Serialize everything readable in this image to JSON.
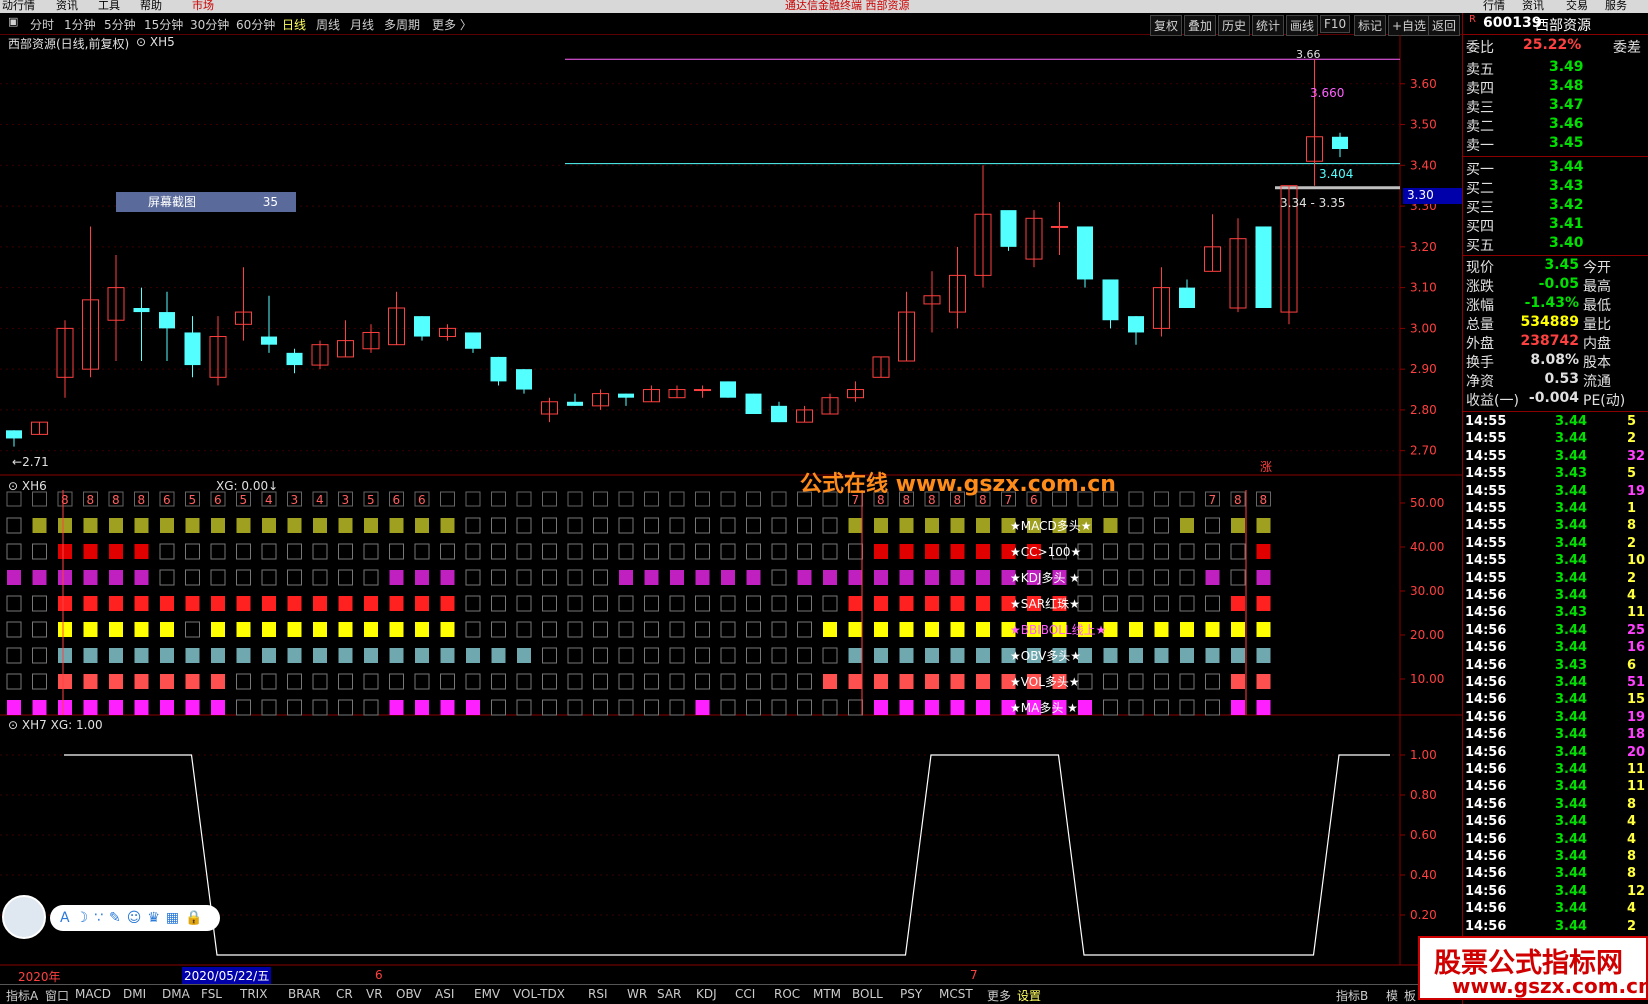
{
  "menubar": {
    "items": [
      "动行情",
      "资讯",
      "工具",
      "帮助",
      "市场"
    ],
    "title": "通达信金融终端  西部资源",
    "right_items": [
      "行情",
      "资讯",
      "交易",
      "服务"
    ]
  },
  "periods": [
    "分时",
    "1分钟",
    "5分钟",
    "15分钟",
    "30分钟",
    "60分钟",
    "日线",
    "周线",
    "月线",
    "多周期",
    "更多 〉"
  ],
  "toolbar": [
    "复权",
    "叠加",
    "历史",
    "统计",
    "画线",
    "F10",
    "标记",
    "+自选",
    "返回"
  ],
  "chart": {
    "title": "西部资源(日线,前复权)",
    "indicator": "XH5",
    "hi_label": "3.66",
    "hi_label2": "3.660",
    "mid_label": "3.404",
    "range_label": "3.34 - 3.35",
    "lo_label": "2.71",
    "cursor_price": "3.30",
    "zhang_tag": "涨",
    "screenshot_tooltip": "屏幕截图",
    "screenshot_num": "35",
    "price_ticks": [
      "3.60",
      "3.50",
      "3.40",
      "3.30",
      "3.20",
      "3.10",
      "3.00",
      "2.90",
      "2.80",
      "2.70"
    ]
  },
  "xh6": {
    "title": "XH6",
    "xg": "XG: 0.00↓",
    "watermark": "公式在线  www.gszx.com.cn",
    "row_labels": [
      "★MACD多头★",
      "★CC>100★",
      "★KDJ多头 ★",
      "★SAR红珠★",
      "★BBIBOLL线上★",
      "★OBV多头★",
      "★VOL多头★",
      "★MA多头 ★"
    ],
    "ticks": [
      "50.00",
      "40.00",
      "30.00",
      "20.00",
      "10.00"
    ],
    "counts": [
      "",
      "",
      "8",
      "8",
      "8",
      "8",
      "6",
      "5",
      "6",
      "5",
      "4",
      "3",
      "4",
      "3",
      "5",
      "6",
      "6",
      "",
      "",
      "",
      "",
      "",
      "",
      "",
      "",
      "",
      "",
      "",
      "",
      "",
      "",
      "",
      "",
      "7",
      "8",
      "8",
      "8",
      "8",
      "8",
      "7",
      "6",
      "",
      "",
      "",
      "",
      "",
      "",
      "7",
      "8",
      "8"
    ]
  },
  "xh7": {
    "title": "XH7",
    "xg": "XG: 1.00",
    "ticks": [
      "1.00",
      "0.80",
      "0.60",
      "0.40",
      "0.20"
    ]
  },
  "dates": {
    "year": "2020年",
    "cursor": "2020/05/22/五",
    "m6": "6",
    "m7": "7"
  },
  "bottom_tabs": [
    "指标A",
    "窗口",
    "MACD",
    "DMI",
    "DMA",
    "FSL",
    "TRIX",
    "BRAR",
    "CR",
    "VR",
    "OBV",
    "ASI",
    "EMV",
    "VOL-TDX",
    "RSI",
    "WR",
    "SAR",
    "KDJ",
    "CCI",
    "ROC",
    "MTM",
    "BOLL",
    "PSY",
    "MCST",
    "更多",
    "设置"
  ],
  "bottom_right": [
    "指标B",
    "模",
    "板"
  ],
  "stock": {
    "code": "600139",
    "name": "西部资源",
    "weibi_label": "委比",
    "weibi": "25.22%",
    "weicha_label": "委差",
    "sell": [
      {
        "label": "卖五",
        "price": "3.49"
      },
      {
        "label": "卖四",
        "price": "3.48"
      },
      {
        "label": "卖三",
        "price": "3.47"
      },
      {
        "label": "卖二",
        "price": "3.46"
      },
      {
        "label": "卖一",
        "price": "3.45"
      }
    ],
    "buy": [
      {
        "label": "买一",
        "price": "3.44"
      },
      {
        "label": "买二",
        "price": "3.43"
      },
      {
        "label": "买三",
        "price": "3.42"
      },
      {
        "label": "买四",
        "price": "3.41"
      },
      {
        "label": "买五",
        "price": "3.40"
      }
    ],
    "stats": [
      {
        "label": "现价",
        "value": "3.45",
        "right": "今开",
        "color": "#00e000"
      },
      {
        "label": "涨跌",
        "value": "-0.05",
        "right": "最高",
        "color": "#00e000"
      },
      {
        "label": "涨幅",
        "value": "-1.43%",
        "right": "最低",
        "color": "#00e000"
      },
      {
        "label": "总量",
        "value": "534889",
        "right": "量比",
        "color": "#ffff00"
      },
      {
        "label": "外盘",
        "value": "238742",
        "right": "内盘",
        "color": "#ff4040"
      },
      {
        "label": "换手",
        "value": "8.08%",
        "right": "股本",
        "color": "#e0e0e0"
      },
      {
        "label": "净资",
        "value": "0.53",
        "right": "流通",
        "color": "#e0e0e0"
      },
      {
        "label": "收益(一)",
        "value": "-0.004",
        "right": "PE(动)",
        "color": "#e0e0e0"
      }
    ],
    "ticks": [
      {
        "t": "14:55",
        "p": "3.44",
        "v": "5"
      },
      {
        "t": "14:55",
        "p": "3.44",
        "v": "2"
      },
      {
        "t": "14:55",
        "p": "3.44",
        "v": "32"
      },
      {
        "t": "14:55",
        "p": "3.43",
        "v": "5"
      },
      {
        "t": "14:55",
        "p": "3.44",
        "v": "19"
      },
      {
        "t": "14:55",
        "p": "3.44",
        "v": "1"
      },
      {
        "t": "14:55",
        "p": "3.44",
        "v": "8"
      },
      {
        "t": "14:55",
        "p": "3.44",
        "v": "2"
      },
      {
        "t": "14:55",
        "p": "3.44",
        "v": "10"
      },
      {
        "t": "14:55",
        "p": "3.44",
        "v": "2"
      },
      {
        "t": "14:56",
        "p": "3.44",
        "v": "4"
      },
      {
        "t": "14:56",
        "p": "3.43",
        "v": "11"
      },
      {
        "t": "14:56",
        "p": "3.44",
        "v": "25"
      },
      {
        "t": "14:56",
        "p": "3.44",
        "v": "16"
      },
      {
        "t": "14:56",
        "p": "3.43",
        "v": "6"
      },
      {
        "t": "14:56",
        "p": "3.44",
        "v": "51"
      },
      {
        "t": "14:56",
        "p": "3.44",
        "v": "15"
      },
      {
        "t": "14:56",
        "p": "3.44",
        "v": "19"
      },
      {
        "t": "14:56",
        "p": "3.44",
        "v": "18"
      },
      {
        "t": "14:56",
        "p": "3.44",
        "v": "20"
      },
      {
        "t": "14:56",
        "p": "3.44",
        "v": "11"
      },
      {
        "t": "14:56",
        "p": "3.44",
        "v": "11"
      },
      {
        "t": "14:56",
        "p": "3.44",
        "v": "8"
      },
      {
        "t": "14:56",
        "p": "3.44",
        "v": "4"
      },
      {
        "t": "14:56",
        "p": "3.44",
        "v": "4"
      },
      {
        "t": "14:56",
        "p": "3.44",
        "v": "8"
      },
      {
        "t": "14:56",
        "p": "3.44",
        "v": "8"
      },
      {
        "t": "14:56",
        "p": "3.44",
        "v": "12"
      },
      {
        "t": "14:56",
        "p": "3.44",
        "v": "4"
      },
      {
        "t": "14:56",
        "p": "3.44",
        "v": "2"
      }
    ]
  },
  "watermark_br": {
    "line1": "股票公式指标网",
    "line2": "www.gszx.com.cn"
  },
  "colors": {
    "up": "#ff4040",
    "down": "#54ffff",
    "grid": "#5a0000"
  },
  "chart_data": {
    "type": "candlestick",
    "candles": [
      [
        2.75,
        2.73,
        2.75,
        2.71
      ],
      [
        2.74,
        2.77,
        2.77,
        2.74
      ],
      [
        2.88,
        3.0,
        3.02,
        2.83
      ],
      [
        2.9,
        3.07,
        3.25,
        2.88
      ],
      [
        3.02,
        3.1,
        3.18,
        2.92
      ],
      [
        3.05,
        3.04,
        3.1,
        2.92
      ],
      [
        3.04,
        3.0,
        3.09,
        2.92
      ],
      [
        2.99,
        2.91,
        3.03,
        2.88
      ],
      [
        2.88,
        2.98,
        3.03,
        2.86
      ],
      [
        3.01,
        3.04,
        3.15,
        2.97
      ],
      [
        2.98,
        2.96,
        3.08,
        2.94
      ],
      [
        2.94,
        2.91,
        2.95,
        2.89
      ],
      [
        2.91,
        2.96,
        2.97,
        2.9
      ],
      [
        2.93,
        2.97,
        3.02,
        2.93
      ],
      [
        2.95,
        2.99,
        3.01,
        2.94
      ],
      [
        2.96,
        3.05,
        3.09,
        2.96
      ],
      [
        3.03,
        2.98,
        3.03,
        2.97
      ],
      [
        2.98,
        3.0,
        3.01,
        2.97
      ],
      [
        2.99,
        2.95,
        2.99,
        2.94
      ],
      [
        2.93,
        2.87,
        2.93,
        2.86
      ],
      [
        2.9,
        2.85,
        2.9,
        2.84
      ],
      [
        2.79,
        2.82,
        2.83,
        2.77
      ],
      [
        2.82,
        2.81,
        2.84,
        2.81
      ],
      [
        2.81,
        2.84,
        2.85,
        2.8
      ],
      [
        2.84,
        2.83,
        2.84,
        2.81
      ],
      [
        2.82,
        2.85,
        2.86,
        2.82
      ],
      [
        2.83,
        2.85,
        2.86,
        2.83
      ],
      [
        2.85,
        2.85,
        2.86,
        2.83
      ],
      [
        2.87,
        2.83,
        2.87,
        2.83
      ],
      [
        2.84,
        2.79,
        2.84,
        2.79
      ],
      [
        2.81,
        2.77,
        2.82,
        2.77
      ],
      [
        2.77,
        2.8,
        2.81,
        2.77
      ],
      [
        2.79,
        2.83,
        2.84,
        2.79
      ],
      [
        2.83,
        2.85,
        2.87,
        2.82
      ],
      [
        2.88,
        2.93,
        2.93,
        2.88
      ],
      [
        2.92,
        3.04,
        3.09,
        2.92
      ],
      [
        3.06,
        3.08,
        3.14,
        2.99
      ],
      [
        3.04,
        3.13,
        3.2,
        3.0
      ],
      [
        3.13,
        3.28,
        3.4,
        3.1
      ],
      [
        3.29,
        3.2,
        3.28,
        3.19
      ],
      [
        3.17,
        3.27,
        3.29,
        3.15
      ],
      [
        3.25,
        3.25,
        3.31,
        3.18
      ],
      [
        3.25,
        3.12,
        3.25,
        3.1
      ],
      [
        3.12,
        3.02,
        3.12,
        3.0
      ],
      [
        3.03,
        2.99,
        3.03,
        2.96
      ],
      [
        3.0,
        3.1,
        3.15,
        2.98
      ],
      [
        3.1,
        3.05,
        3.12,
        3.05
      ],
      [
        3.14,
        3.2,
        3.28,
        3.14
      ],
      [
        3.05,
        3.22,
        3.27,
        3.04
      ],
      [
        3.25,
        3.05,
        3.25,
        3.05
      ],
      [
        3.04,
        3.35,
        3.35,
        3.01
      ],
      [
        3.41,
        3.47,
        3.66,
        3.35
      ],
      [
        3.47,
        3.44,
        3.48,
        3.42
      ]
    ],
    "ylim": [
      2.66,
      3.7
    ],
    "yticks": [
      2.7,
      2.8,
      2.9,
      3.0,
      3.1,
      3.2,
      3.3,
      3.4,
      3.5,
      3.6
    ],
    "hlines": [
      3.66,
      3.404
    ],
    "xh7_values": [
      1,
      1,
      1,
      1,
      1,
      1,
      0,
      0,
      0,
      0,
      0,
      0,
      0,
      0,
      0,
      0,
      0,
      0,
      0,
      0,
      0,
      0,
      0,
      0,
      0,
      0,
      0,
      0,
      0,
      0,
      0,
      0,
      0,
      0,
      1,
      1,
      1,
      1,
      1,
      1,
      0,
      0,
      0,
      0,
      0,
      0,
      0,
      0,
      0,
      0,
      1,
      1,
      1
    ],
    "xh7_ylim": [
      0,
      1.1
    ]
  }
}
